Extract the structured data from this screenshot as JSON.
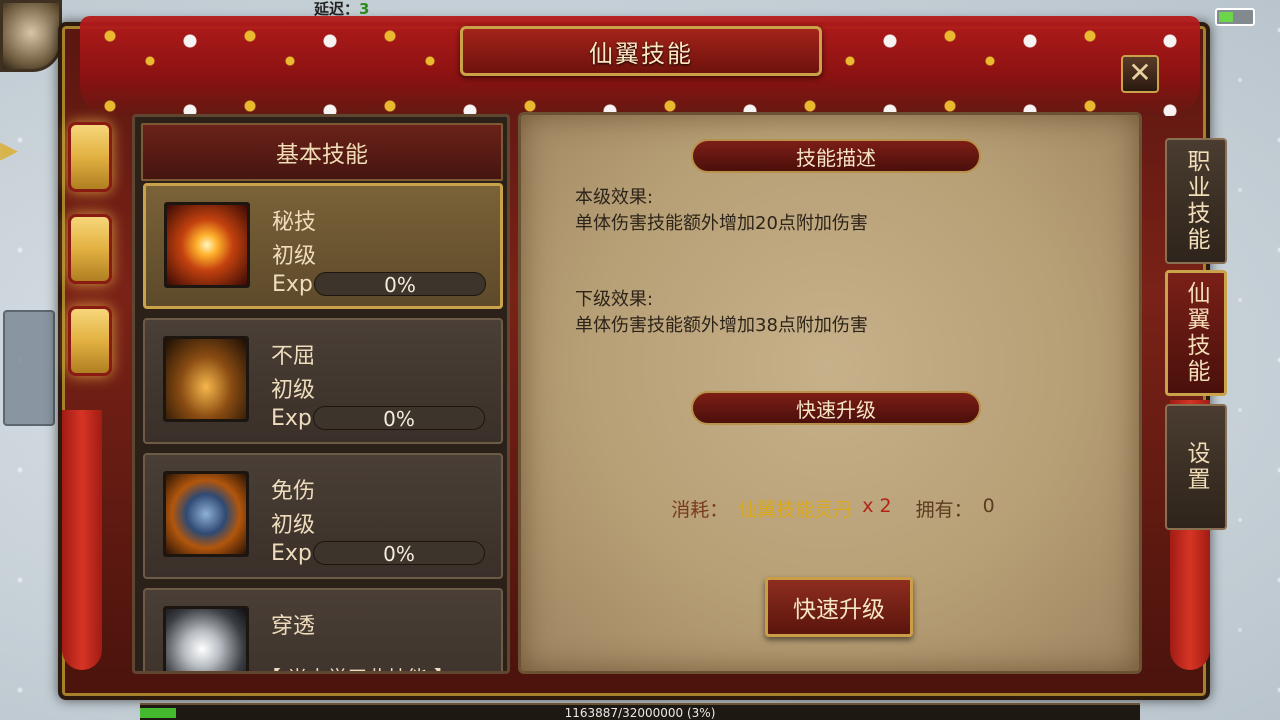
{
  "hud": {
    "latency_label": "延迟：",
    "latency_value": "3"
  },
  "dialog": {
    "title": "仙翼技能",
    "close_label": "✕"
  },
  "skills_panel": {
    "header": "基本技能",
    "skills": [
      {
        "name": "秘技",
        "level": "初级",
        "exp_label": "Exp",
        "exp_text": "0%",
        "exp_progress": 0,
        "icon": "burst-icon",
        "selected": true
      },
      {
        "name": "不屈",
        "level": "初级",
        "exp_label": "Exp",
        "exp_text": "0%",
        "exp_progress": 0,
        "icon": "winged-warrior-icon",
        "selected": false
      },
      {
        "name": "免伤",
        "level": "初级",
        "exp_label": "Exp",
        "exp_text": "0%",
        "exp_progress": 0,
        "icon": "shield-icon",
        "selected": false
      },
      {
        "name": "穿透",
        "status": "【 尚未学习此技能 】",
        "icon": "pierce-icon",
        "selected": false
      }
    ]
  },
  "description": {
    "section_title": "技能描述",
    "current_label": "本级效果:",
    "current_text": "单体伤害技能额外增加20点附加伤害",
    "next_label": "下级效果:",
    "next_text": "单体伤害技能额外增加38点附加伤害"
  },
  "quick_upgrade": {
    "section_title": "快速升级",
    "cost_label": "消耗：",
    "cost_item": "仙翼技能灵丹",
    "cost_count": "x 2",
    "owned_label": "拥有：",
    "owned_value": "0",
    "button_label": "快速升级"
  },
  "side_tabs": [
    {
      "label": "职业技能",
      "active": false
    },
    {
      "label": "仙翼技能",
      "active": true
    },
    {
      "label": "设置",
      "active": false
    }
  ],
  "exp_bar": {
    "text": "1163887/32000000 (3%)",
    "progress": 0.036
  },
  "colors": {
    "accent_gold": "#c9a24a",
    "panel_red": "#7a2018",
    "cost_item_yellow": "#d9a81e",
    "cost_count_red": "#b32418",
    "exp_green": "#44b82e"
  }
}
